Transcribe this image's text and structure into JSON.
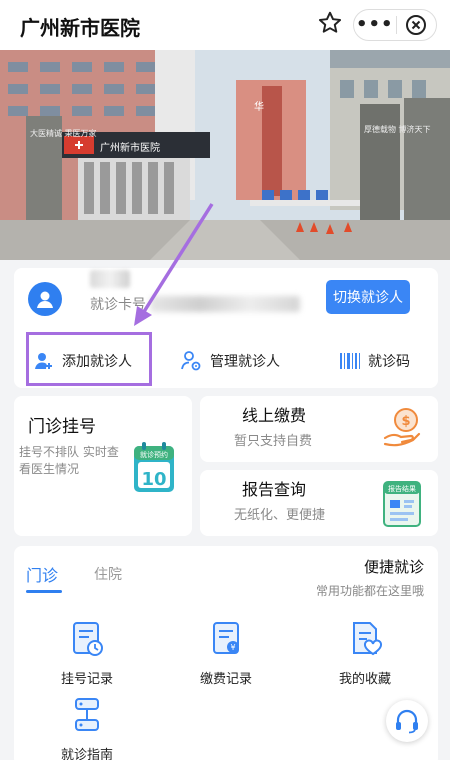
{
  "app": {
    "title": "广州新市医院"
  },
  "capsule": {
    "more": "•••"
  },
  "banner": {
    "gate_left_text": "大医精诚 秉医万家",
    "gate_right_text": "厚德载物 博济天下",
    "building_sign": "华",
    "gate_sign": "广州新市医院"
  },
  "patient": {
    "card_label": "就诊卡号",
    "switch_label": "切换就诊人",
    "actions": [
      {
        "label": "添加就诊人",
        "icon": "add-user-icon"
      },
      {
        "label": "管理就诊人",
        "icon": "manage-user-icon"
      },
      {
        "label": "就诊码",
        "icon": "barcode-icon"
      }
    ]
  },
  "services": {
    "register": {
      "title": "门诊挂号",
      "desc": "挂号不排队 实时查看医生情况",
      "icon_badge": "就诊预约",
      "icon_num": "10"
    },
    "payment": {
      "title": "线上缴费",
      "desc": "暂只支持自费",
      "icon": "dollar-hand-icon"
    },
    "report": {
      "title": "报告查询",
      "desc": "无纸化、更便捷",
      "icon_badge": "报告结果"
    }
  },
  "panel": {
    "tabs": [
      {
        "label": "门诊",
        "active": true
      },
      {
        "label": "住院",
        "active": false
      }
    ],
    "quick_title": "便捷就诊",
    "quick_sub": "常用功能都在这里哦",
    "functions": [
      {
        "label": "挂号记录",
        "icon": "register-record-icon"
      },
      {
        "label": "缴费记录",
        "icon": "payment-record-icon"
      },
      {
        "label": "我的收藏",
        "icon": "favorite-icon"
      },
      {
        "label": "就诊指南",
        "icon": "guide-icon"
      }
    ]
  },
  "colors": {
    "accent": "#2f7ff0",
    "highlight": "#a56ee0",
    "orange": "#f08a3c",
    "green": "#3fb27f"
  }
}
